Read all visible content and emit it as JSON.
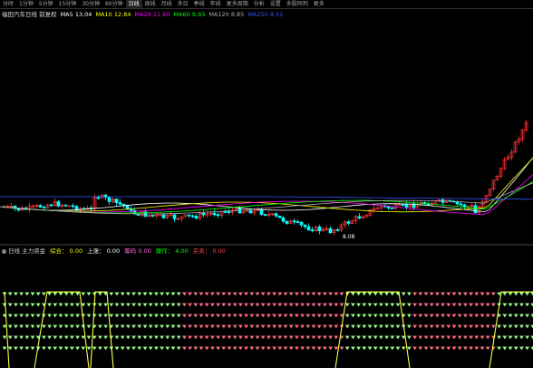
{
  "tabs": [
    "分时",
    "1分钟",
    "5分钟",
    "15分钟",
    "30分钟",
    "60分钟",
    "日线",
    "周线",
    "月线",
    "多日",
    "季线",
    "年线",
    "更多周期",
    "分析",
    "设置",
    "多股同列",
    "更多"
  ],
  "active_tab": 6,
  "main_legend": {
    "title": "福田汽车日线 前复权",
    "items": [
      {
        "label": "MA5",
        "value": "13.04",
        "color": "#ffffff"
      },
      {
        "label": "MA10",
        "value": "12.84",
        "color": "#ffff00"
      },
      {
        "label": "MA20",
        "value": "11.60",
        "color": "#ff00ff"
      },
      {
        "label": "MA60",
        "value": "9.93",
        "color": "#00ff00"
      },
      {
        "label": "MA120",
        "value": "8.85",
        "color": "#aaaaaa"
      },
      {
        "label": "MA250",
        "value": "8.52",
        "color": "#3355ff"
      }
    ]
  },
  "low_label": "8.08",
  "sub_legend": {
    "title": "日线 主力资金",
    "items": [
      {
        "label": "综合：",
        "value": "0.00",
        "color": "#ffff00"
      },
      {
        "label": "上涨：",
        "value": "0.00",
        "color": "#ffffff"
      },
      {
        "label": "筹码",
        "value": "0.00",
        "color": "#ff66cc"
      },
      {
        "label": "操作：",
        "value": "4.00",
        "color": "#00ff00"
      },
      {
        "label": "买卖：",
        "value": "0.00",
        "color": "#ff4444"
      }
    ]
  },
  "colors": {
    "up": "#ff3333",
    "down": "#00ffff",
    "signal": "#ffff44",
    "dot_red": "#ff6f88",
    "dot_green": "#9cff8c"
  }
}
